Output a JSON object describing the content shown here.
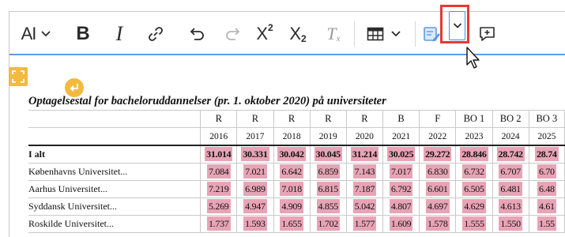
{
  "toolbar": {
    "font_size_glyph": "AI",
    "bold_label": "B",
    "italic_label": "I",
    "superscript_label": "X",
    "superscript_mark": "2",
    "subscript_label": "X",
    "subscript_mark": "2",
    "clear_format_label": "T",
    "clear_format_mark": "x"
  },
  "table": {
    "caption": "Optagelsestal for bacheloruddannelser (pr. 1. oktober 2020) på universiteter",
    "header_row1": [
      "R",
      "R",
      "R",
      "R",
      "R",
      "B",
      "F",
      "BO 1",
      "BO 2",
      "BO 3"
    ],
    "header_row2": [
      "2016",
      "2017",
      "2018",
      "2019",
      "2020",
      "2021",
      "2022",
      "2023",
      "2024",
      "2025"
    ],
    "rows": [
      {
        "label": "I alt",
        "values": [
          "31.014",
          "30.331",
          "30.042",
          "30.045",
          "31.214",
          "30.025",
          "29.272",
          "28.846",
          "28.742",
          "28.74"
        ]
      },
      {
        "label": "Københavns Universitet...",
        "values": [
          "7.084",
          "7.021",
          "6.642",
          "6.859",
          "7.143",
          "7.017",
          "6.830",
          "6.732",
          "6.707",
          "6.70"
        ]
      },
      {
        "label": "Aarhus Universitet...",
        "values": [
          "7.219",
          "6.989",
          "7.018",
          "6.815",
          "7.187",
          "6.792",
          "6.601",
          "6.505",
          "6.481",
          "6.48"
        ]
      },
      {
        "label": "Syddansk Universitet...",
        "values": [
          "5.269",
          "4.947",
          "4.909",
          "4.855",
          "5.042",
          "4.807",
          "4.697",
          "4.629",
          "4.613",
          "4.61"
        ]
      },
      {
        "label": "Roskilde Universitet...",
        "values": [
          "1.737",
          "1.593",
          "1.655",
          "1.702",
          "1.577",
          "1.609",
          "1.578",
          "1.555",
          "1.550",
          "1.55"
        ]
      }
    ]
  },
  "colors": {
    "highlight": "#e8a4b6",
    "focus_border": "#5b9be8",
    "callout": "#e53935",
    "marker": "#f4b940"
  }
}
